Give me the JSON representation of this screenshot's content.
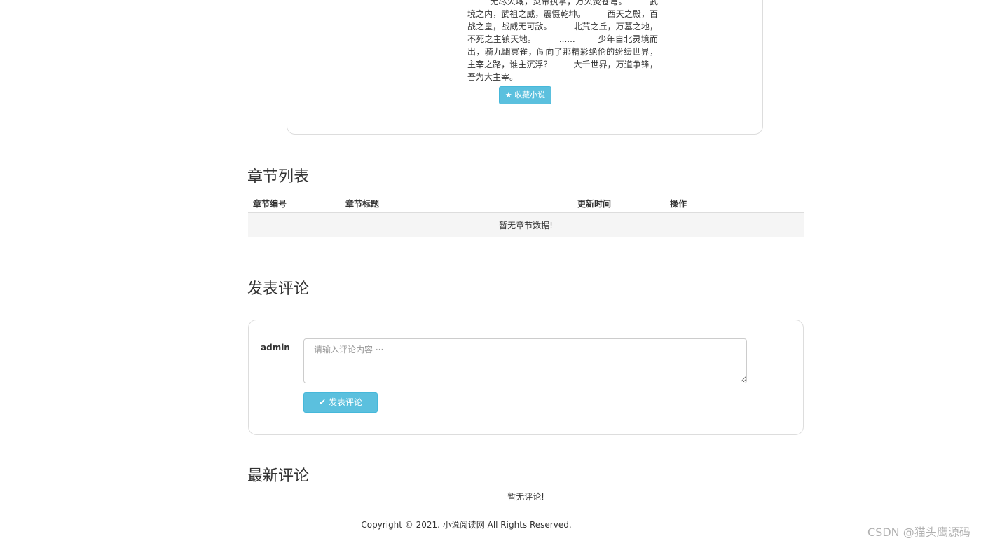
{
  "novel": {
    "description": "        无尽火域，炎帝执掌，万火焚苍穹。        武境之内，武祖之威，震慑乾坤。        西天之殿，百战之皇，战威无可敌。        北荒之丘，万墓之地，不死之主镇天地。        ......        少年自北灵境而出，骑九幽冥雀，闯向了那精彩绝伦的纷纭世界，主宰之路，谁主沉浮？        大千世界，万道争锋，吾为大主宰。",
    "favorite_icon": "star-icon",
    "favorite_glyph": "★",
    "favorite_label": "收藏小说"
  },
  "chapters": {
    "title": "章节列表",
    "columns": [
      "章节编号",
      "章节标题",
      "更新时间",
      "操作"
    ],
    "empty_text": "暂无章节数据!"
  },
  "comment_form": {
    "title": "发表评论",
    "user": "admin",
    "placeholder": "请输入评论内容 ···",
    "value": "",
    "submit_icon": "check-icon",
    "submit_glyph": "✔",
    "submit_label": "发表评论"
  },
  "latest_comments": {
    "title": "最新评论",
    "empty_text": "暂无评论!"
  },
  "footer": {
    "copyright": "Copyright © 2021. 小说阅读网 All Rights Reserved."
  },
  "watermark": {
    "text": "CSDN @猫头鹰源码"
  },
  "colors": {
    "button": "#5bc0de",
    "border": "#dddddd",
    "text": "#333333"
  }
}
